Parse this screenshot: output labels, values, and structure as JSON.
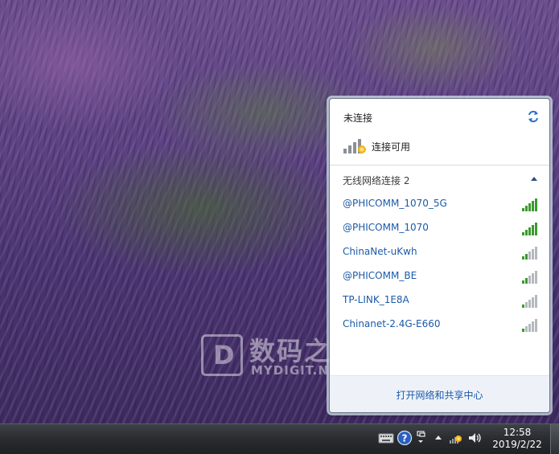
{
  "wallpaper": {
    "watermark_cn": "数码之家",
    "watermark_en": "MYDIGIT.NET"
  },
  "flyout": {
    "status_title": "未连接",
    "status_text": "连接可用",
    "section_label": "无线网络连接 2",
    "networks": [
      {
        "name": "@PHICOMM_1070_5G",
        "bars": 5,
        "secured": false
      },
      {
        "name": "@PHICOMM_1070",
        "bars": 5,
        "secured": false
      },
      {
        "name": "ChinaNet-uKwh",
        "bars": 2,
        "secured": false
      },
      {
        "name": "@PHICOMM_BE",
        "bars": 2,
        "secured": false
      },
      {
        "name": "TP-LINK_1E8A",
        "bars": 1,
        "secured": false
      },
      {
        "name": "Chinanet-2.4G-E660",
        "bars": 1,
        "secured": false
      }
    ],
    "footer_link": "打开网络和共享中心"
  },
  "taskbar": {
    "time": "12:58",
    "date": "2019/2/22"
  },
  "colors": {
    "link": "#1c5aa8",
    "signal_on": "#3a9a2e",
    "signal_off": "#b4b9be"
  }
}
